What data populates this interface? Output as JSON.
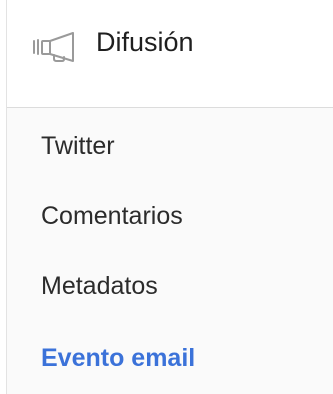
{
  "header": {
    "icon": "megaphone-icon",
    "title": "Difusión"
  },
  "menu": {
    "items": [
      {
        "label": "Twitter",
        "active": false
      },
      {
        "label": "Comentarios",
        "active": false
      },
      {
        "label": "Metadatos",
        "active": false
      },
      {
        "label": "Evento email",
        "active": true
      }
    ]
  },
  "colors": {
    "active": "#3b72d9",
    "text": "#2b2b2b",
    "icon": "#9a9a9a",
    "divider": "#dcdcdc"
  }
}
